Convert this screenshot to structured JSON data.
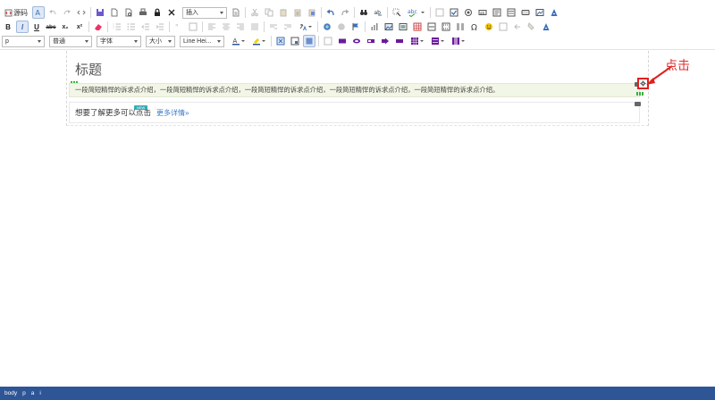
{
  "toolbar": {
    "source_label": "源码",
    "insert_dropdown": "插入",
    "paragraph_dropdown": "p",
    "style_dropdown": "普通",
    "font_family_dropdown": "字体",
    "font_size_dropdown": "大小",
    "line_height_dropdown": "Line Hei...",
    "bold_label": "B",
    "italic_label": "I",
    "underline_label": "U",
    "strike_label": "abc",
    "subscript_label": "x₂",
    "superscript_label": "x²",
    "accent_color": "#3b7bc6"
  },
  "document": {
    "title": "标题",
    "paragraph1": "一段简短精悍的诉求点介绍，一段简短精悍的诉求点介绍，一段简短精悍的诉求点介绍，一段简短精悍的诉求点介绍，一段简短精悍的诉求点介绍。",
    "paragraph2_text": "想要了解更多可以点击",
    "paragraph2_link": "更多详情»",
    "badge": "NEW"
  },
  "annotation": {
    "callout_text": "点击",
    "highlight_color": "#e02020"
  },
  "statusbar": {
    "path": [
      "body",
      "p",
      "a",
      "i"
    ],
    "background": "#2e5596"
  }
}
